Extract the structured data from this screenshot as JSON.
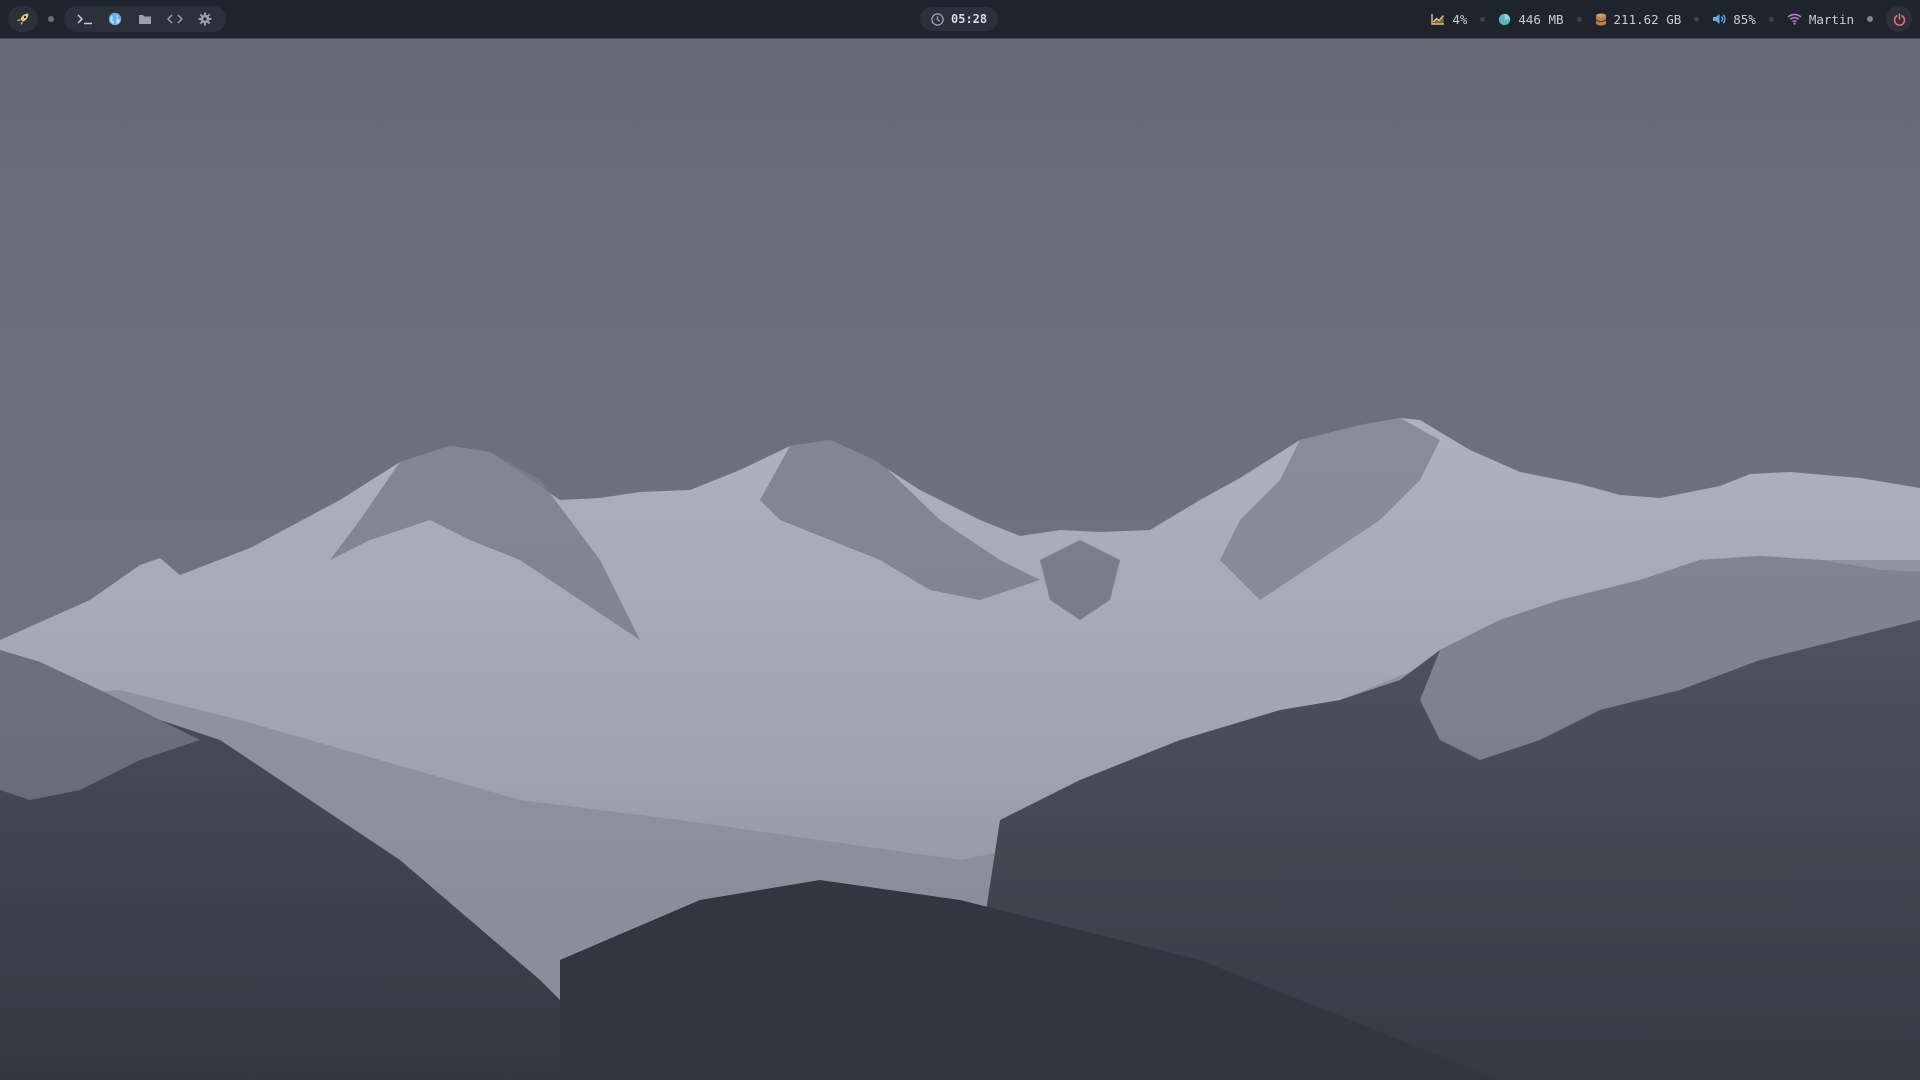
{
  "topbar": {
    "left": {
      "launcher_icon": "rocket-icon",
      "apps": [
        {
          "name": "terminal",
          "icon": "terminal-icon"
        },
        {
          "name": "browser",
          "icon": "globe-icon"
        },
        {
          "name": "files",
          "icon": "folder-icon"
        },
        {
          "name": "code-editor",
          "icon": "code-icon"
        },
        {
          "name": "settings",
          "icon": "gear-icon"
        }
      ]
    },
    "clock": {
      "icon": "clock-icon",
      "time": "05:28"
    },
    "stats": {
      "cpu": {
        "icon": "chart-icon",
        "value": "4%"
      },
      "memory": {
        "icon": "pie-icon",
        "value": "446 MB"
      },
      "disk": {
        "icon": "database-icon",
        "value": "211.62 GB"
      },
      "volume": {
        "icon": "speaker-icon",
        "value": "85%"
      },
      "network": {
        "icon": "wifi-icon",
        "value": "Martin"
      }
    },
    "power_icon": "power-icon"
  },
  "colors": {
    "bar_bg": "#1f232b",
    "pill_bg": "#2b303a",
    "accent_yellow": "#e5c07b",
    "accent_blue": "#61afef",
    "accent_teal": "#56b6c2",
    "accent_orange": "#d19a66",
    "accent_magenta": "#c678dd",
    "accent_red": "#e06c75"
  },
  "wallpaper": {
    "subject": "snowy-mountain-range"
  }
}
